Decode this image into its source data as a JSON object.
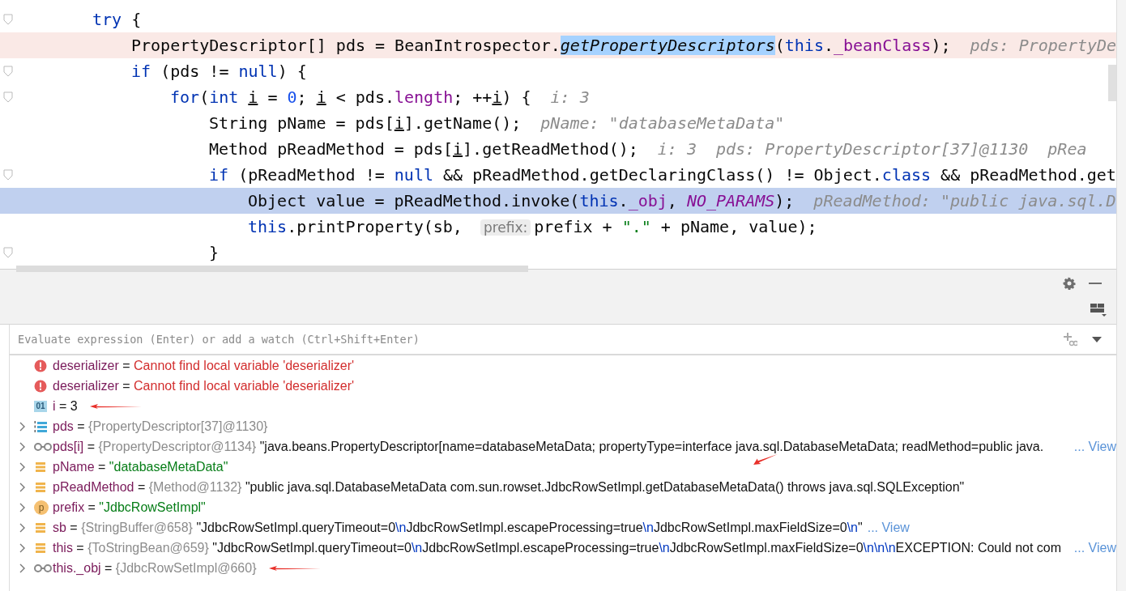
{
  "editor": {
    "lines": [
      {
        "fold": true,
        "highlighted": false,
        "current": false,
        "tokens": [
          {
            "t": "try",
            "kind": "keyword"
          },
          {
            "t": " {",
            "kind": "plain"
          }
        ],
        "children": [
          {
            "fold": false,
            "highlighted": true,
            "current": false,
            "tokens": [
              {
                "t": "PropertyDescriptor[] pds = BeanIntrospector.",
                "kind": "plain"
              },
              {
                "t": "getPropertyDescriptors",
                "kind": "selection"
              },
              {
                "t": "(",
                "kind": "plain"
              },
              {
                "t": "this",
                "kind": "keyword"
              },
              {
                "t": ".",
                "kind": "plain"
              },
              {
                "t": "_beanClass",
                "kind": "field"
              },
              {
                "t": ");",
                "kind": "plain"
              },
              {
                "t": "pds: PropertyDe",
                "kind": "hint"
              }
            ]
          },
          {
            "fold": true,
            "highlighted": false,
            "current": false,
            "tokens": [
              {
                "t": "if",
                "kind": "keyword"
              },
              {
                "t": " (pds != ",
                "kind": "plain"
              },
              {
                "t": "null",
                "kind": "keyword"
              },
              {
                "t": ") {",
                "kind": "plain"
              }
            ],
            "children": [
              {
                "fold": true,
                "highlighted": false,
                "current": false,
                "tokens": [
                  {
                    "t": "for",
                    "kind": "keyword"
                  },
                  {
                    "t": "(",
                    "kind": "plain"
                  },
                  {
                    "t": "int",
                    "kind": "keyword"
                  },
                  {
                    "t": "i",
                    "kind": "spaced_variable"
                  },
                  {
                    "t": " = ",
                    "kind": "plain"
                  },
                  {
                    "t": "0",
                    "kind": "number"
                  },
                  {
                    "t": "; ",
                    "kind": "plain"
                  },
                  {
                    "t": "i",
                    "kind": "variable"
                  },
                  {
                    "t": " < pds.",
                    "kind": "plain"
                  },
                  {
                    "t": "length",
                    "kind": "field"
                  },
                  {
                    "t": "; ++",
                    "kind": "plain"
                  },
                  {
                    "t": "i",
                    "kind": "variable"
                  },
                  {
                    "t": ") {",
                    "kind": "plain"
                  },
                  {
                    "t": "i: 3",
                    "kind": "hint"
                  }
                ],
                "children": [
                  {
                    "fold": false,
                    "highlighted": false,
                    "current": false,
                    "tokens": [
                      {
                        "t": "String pName = pds[",
                        "kind": "plain"
                      },
                      {
                        "t": "i",
                        "kind": "variable"
                      },
                      {
                        "t": "].getName();",
                        "kind": "plain"
                      },
                      {
                        "t": "pName: \"databaseMetaData\"",
                        "kind": "hint"
                      }
                    ]
                  },
                  {
                    "fold": false,
                    "highlighted": false,
                    "current": false,
                    "tokens": [
                      {
                        "t": "Method pReadMethod = pds[",
                        "kind": "plain"
                      },
                      {
                        "t": "i",
                        "kind": "variable"
                      },
                      {
                        "t": "].getReadMethod();",
                        "kind": "plain"
                      },
                      {
                        "t": "i: 3",
                        "kind": "hint"
                      },
                      {
                        "t": "pds: PropertyDescriptor[37]@1130",
                        "kind": "hint"
                      },
                      {
                        "t": "pRea",
                        "kind": "hint"
                      }
                    ]
                  },
                  {
                    "fold": true,
                    "highlighted": false,
                    "current": false,
                    "tokens": [
                      {
                        "t": "if",
                        "kind": "keyword"
                      },
                      {
                        "t": " (pReadMethod != ",
                        "kind": "plain"
                      },
                      {
                        "t": "null",
                        "kind": "keyword"
                      },
                      {
                        "t": " && pReadMethod.getDeclaringClass() != Object.",
                        "kind": "plain"
                      },
                      {
                        "t": "class",
                        "kind": "keyword"
                      },
                      {
                        "t": " && pReadMethod.get",
                        "kind": "plain"
                      }
                    ],
                    "children": [
                      {
                        "fold": false,
                        "highlighted": false,
                        "current": true,
                        "tokens": [
                          {
                            "t": "Object value = pReadMethod.invoke(",
                            "kind": "plain"
                          },
                          {
                            "t": "this",
                            "kind": "keyword"
                          },
                          {
                            "t": ".",
                            "kind": "plain"
                          },
                          {
                            "t": "_obj",
                            "kind": "field"
                          },
                          {
                            "t": ", ",
                            "kind": "plain"
                          },
                          {
                            "t": "NO_PARAMS",
                            "kind": "constant"
                          },
                          {
                            "t": ");",
                            "kind": "plain"
                          },
                          {
                            "t": "pReadMethod: \"public java.sql.D",
                            "kind": "hint"
                          }
                        ]
                      },
                      {
                        "fold": false,
                        "highlighted": false,
                        "current": false,
                        "tokens": [
                          {
                            "t": "this",
                            "kind": "keyword"
                          },
                          {
                            "t": ".printProperty(sb, ",
                            "kind": "plain"
                          },
                          {
                            "t": "prefix:",
                            "kind": "param_hint"
                          },
                          {
                            "t": "prefix + ",
                            "kind": "plain"
                          },
                          {
                            "t": "\".\"",
                            "kind": "string"
                          },
                          {
                            "t": " + pName, value);",
                            "kind": "plain"
                          }
                        ]
                      }
                    ]
                  },
                  {
                    "fold": true,
                    "highlighted": false,
                    "current": false,
                    "tokens": [
                      {
                        "t": "}",
                        "kind": "plain"
                      }
                    ]
                  }
                ]
              }
            ]
          }
        ]
      }
    ]
  },
  "debugger": {
    "watch_field": {
      "placeholder": "Evaluate expression (Enter) or add a watch (Ctrl+Shift+Enter)"
    },
    "variables": [
      {
        "expandable": false,
        "kind": "error",
        "tokens": [
          {
            "t": "deserializer",
            "kind": "name"
          },
          {
            "t": " = ",
            "kind": "op"
          },
          {
            "t": "Cannot find local variable 'deserializer'",
            "kind": "error"
          }
        ]
      },
      {
        "expandable": false,
        "kind": "error",
        "tokens": [
          {
            "t": "deserializer",
            "kind": "name"
          },
          {
            "t": " = ",
            "kind": "op"
          },
          {
            "t": "Cannot find local variable 'deserializer'",
            "kind": "error"
          }
        ]
      },
      {
        "expandable": false,
        "kind": "primitive",
        "badge": "01",
        "annotation": {
          "kind": "left_arrow"
        },
        "tokens": [
          {
            "t": "i",
            "kind": "name"
          },
          {
            "t": " = ",
            "kind": "op"
          },
          {
            "t": "3",
            "kind": "text"
          }
        ]
      },
      {
        "expandable": true,
        "kind": "array",
        "tokens": [
          {
            "t": "pds",
            "kind": "name"
          },
          {
            "t": " = ",
            "kind": "op"
          },
          {
            "t": "{PropertyDescriptor[37]@1130}",
            "kind": "ref"
          }
        ]
      },
      {
        "expandable": true,
        "kind": "watch",
        "tokens": [
          {
            "t": "pds[i]",
            "kind": "name"
          },
          {
            "t": " = ",
            "kind": "op"
          },
          {
            "t": "{PropertyDescriptor@1134}",
            "kind": "ref"
          },
          {
            "t": " \"java.beans.PropertyDescriptor[name=databaseMetaData; propertyType=interface java.sql.DatabaseMetaData; readMethod=public java.",
            "kind": "text"
          }
        ],
        "link": "... View",
        "link_inline": false
      },
      {
        "expandable": true,
        "kind": "field",
        "annotation": {
          "kind": "slanted_arrow"
        },
        "tokens": [
          {
            "t": "pName",
            "kind": "name"
          },
          {
            "t": " = ",
            "kind": "op"
          },
          {
            "t": "\"databaseMetaData\"",
            "kind": "string"
          }
        ]
      },
      {
        "expandable": true,
        "kind": "field",
        "tokens": [
          {
            "t": "pReadMethod",
            "kind": "name"
          },
          {
            "t": " = ",
            "kind": "op"
          },
          {
            "t": "{Method@1132}",
            "kind": "ref"
          },
          {
            "t": " \"public java.sql.DatabaseMetaData com.sun.rowset.JdbcRowSetImpl.getDatabaseMetaData() throws java.sql.SQLException\"",
            "kind": "text"
          }
        ]
      },
      {
        "expandable": true,
        "kind": "parameter",
        "badge": "p",
        "tokens": [
          {
            "t": "prefix",
            "kind": "name"
          },
          {
            "t": " = ",
            "kind": "op"
          },
          {
            "t": "\"JdbcRowSetImpl\"",
            "kind": "string"
          }
        ]
      },
      {
        "expandable": true,
        "kind": "field",
        "tokens": [
          {
            "t": "sb",
            "kind": "name"
          },
          {
            "t": " = ",
            "kind": "op"
          },
          {
            "t": "{StringBuffer@658}",
            "kind": "ref"
          },
          {
            "t": " \"JdbcRowSetImpl.queryTimeout=0",
            "kind": "text"
          },
          {
            "t": "\\n",
            "kind": "escape"
          },
          {
            "t": "JdbcRowSetImpl.escapeProcessing=true",
            "kind": "text"
          },
          {
            "t": "\\n",
            "kind": "escape"
          },
          {
            "t": "JdbcRowSetImpl.maxFieldSize=0",
            "kind": "text"
          },
          {
            "t": "\\n",
            "kind": "escape"
          },
          {
            "t": "\"",
            "kind": "text"
          }
        ],
        "link": "... View",
        "link_inline": true
      },
      {
        "expandable": true,
        "kind": "field",
        "tokens": [
          {
            "t": "this",
            "kind": "name"
          },
          {
            "t": " = ",
            "kind": "op"
          },
          {
            "t": "{ToStringBean@659}",
            "kind": "ref"
          },
          {
            "t": " \"JdbcRowSetImpl.queryTimeout=0",
            "kind": "text"
          },
          {
            "t": "\\n",
            "kind": "escape"
          },
          {
            "t": "JdbcRowSetImpl.escapeProcessing=true",
            "kind": "text"
          },
          {
            "t": "\\n",
            "kind": "escape"
          },
          {
            "t": "JdbcRowSetImpl.maxFieldSize=0",
            "kind": "text"
          },
          {
            "t": "\\n\\n\\n",
            "kind": "escape"
          },
          {
            "t": "EXCEPTION: Could not com",
            "kind": "text"
          }
        ],
        "link": "... View",
        "link_inline": false
      },
      {
        "expandable": true,
        "kind": "watch",
        "annotation": {
          "kind": "left_arrow"
        },
        "tokens": [
          {
            "t": "this._obj",
            "kind": "name"
          },
          {
            "t": " = ",
            "kind": "op"
          },
          {
            "t": "{JdbcRowSetImpl@660}",
            "kind": "ref"
          }
        ]
      }
    ]
  }
}
